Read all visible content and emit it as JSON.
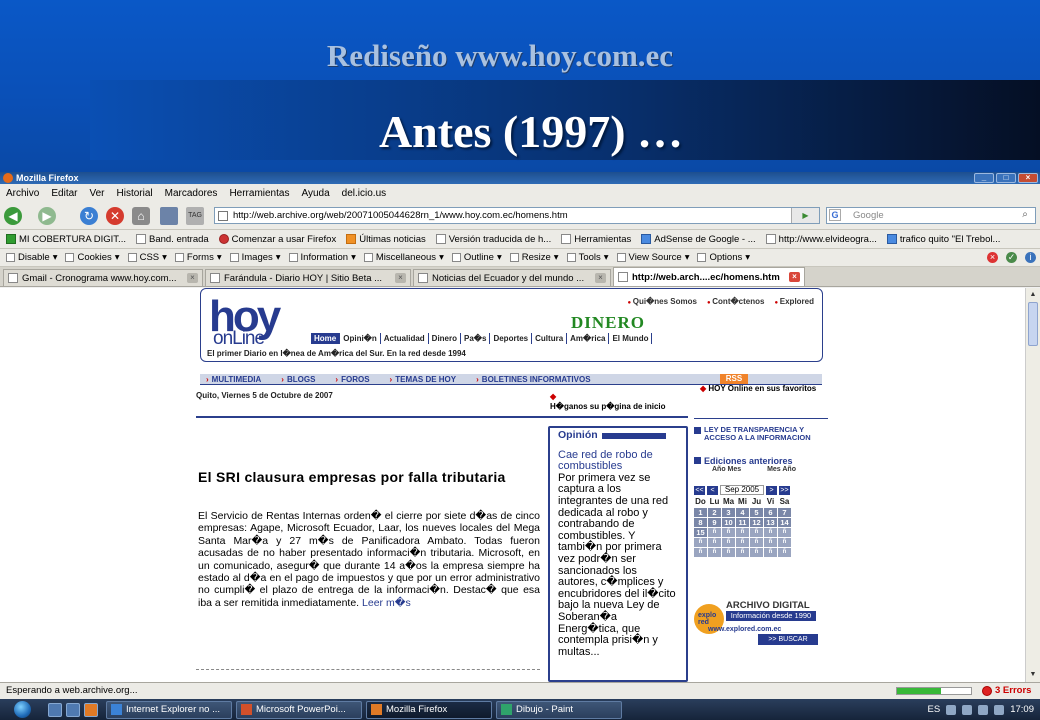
{
  "slide": {
    "subtitle": "Rediseño www.hoy.com.ec",
    "title": "Antes (1997) …"
  },
  "window": {
    "title": "Mozilla Firefox",
    "controls": [
      "_",
      "□",
      "×"
    ]
  },
  "menu": [
    "Archivo",
    "Editar",
    "Ver",
    "Historial",
    "Marcadores",
    "Herramientas",
    "Ayuda",
    "del.icio.us"
  ],
  "nav": {
    "back": "◀",
    "forward": "▶",
    "reload": "↻",
    "stop": "✕",
    "home": "⌂",
    "url": "http://web.archive.org/web/20071005044628rn_1/www.hoy.com.ec/homens.htm",
    "go": "▶",
    "search_placeholder": "Google",
    "search_engine": "G"
  },
  "bookmarks": [
    {
      "label": "MI COBERTURA DIGIT...",
      "icon": "green"
    },
    {
      "label": "Band. entrada",
      "icon": "plain"
    },
    {
      "label": "Comenzar a usar Firefox",
      "icon": "red"
    },
    {
      "label": "Últimas noticias",
      "icon": "orange"
    },
    {
      "label": "Versión traducida de h...",
      "icon": "plain"
    },
    {
      "label": "Herramientas",
      "icon": "plain"
    },
    {
      "label": "AdSense de Google - ...",
      "icon": "gd"
    },
    {
      "label": "http://www.elvideogra...",
      "icon": "plain"
    },
    {
      "label": "trafico quito \"El Trebol...",
      "icon": "gd"
    }
  ],
  "webdev": [
    "Disable",
    "Cookies",
    "CSS",
    "Forms",
    "Images",
    "Information",
    "Miscellaneous",
    "Outline",
    "Resize",
    "Tools",
    "View Source",
    "Options"
  ],
  "tabs": [
    {
      "label": "Gmail - Cronograma www.hoy.com...",
      "active": false
    },
    {
      "label": "Farándula - Diario HOY | Sitio Beta ...",
      "active": false
    },
    {
      "label": "Noticias del Ecuador y del mundo ...",
      "active": false
    },
    {
      "label": "http://web.arch....ec/homens.htm",
      "active": true
    }
  ],
  "site": {
    "logo_top": "hoy",
    "logo_bottom": "onLine",
    "top_links": [
      "Qui�nes Somos",
      "Cont�ctenos",
      "Explored"
    ],
    "dinero": "DINERO",
    "nav": [
      "Home",
      "Opini�n",
      "Actualidad",
      "Dinero",
      "Pa�s",
      "Deportes",
      "Cultura",
      "Am�rica",
      "El Mundo"
    ],
    "tagline": "El primer Diario en l�nea de Am�rica del Sur. En la red desde 1994",
    "sections": [
      "MULTIMEDIA",
      "BLOGS",
      "FOROS",
      "TEMAS DE HOY",
      "BOLETINES INFORMATIVOS"
    ],
    "rss": "RSS",
    "date": "Quito, Viernes 5 de Octubre de 2007",
    "hagan": "H�ganos su p�gina de inicio",
    "favoritos": "HOY Online en sus favoritos",
    "article": {
      "title": "El SRI clausura empresas por falla tributaria",
      "body": "El Servicio de Rentas Internas orden� el cierre por siete d�as de cinco empresas: Agape, Microsoft Ecuador, Laar, los nueves locales del Mega Santa Mar�a y 27 m�s de Panificadora Ambato. Todas fueron acusadas de no haber presentado informaci�n tributaria. Microsoft, en un comunicado, asegur� que durante 14 a�os la empresa siempre ha estado al d�a en el pago de impuestos y que por un error administrativo no cumpli� el plazo de entrega de la informaci�n. Destac� que esa iba a ser remitida inmediatamente.",
      "more": "Leer m�s"
    },
    "opinion": {
      "heading": "Opinión",
      "link": "Cae red de robo de combustibles",
      "text": "Por primera vez se captura a los integrantes de una red dedicada al robo y contrabando de combustibles. Y tambi�n por primera vez podr�n ser sancionados los autores, c�mplices y encubridores del il�cito bajo la nueva Ley de Soberan�a Energ�tica, que contempla prisi�n y multas..."
    },
    "ley": "LEY DE TRANSPARENCIA Y ACCESO A LA INFORMACION",
    "ediciones": {
      "title": "Ediciones anteriores",
      "year_label": "Año Mes",
      "month_label": "Mes Año"
    },
    "calendar": {
      "month": "Sep 2005",
      "prev": [
        "<<",
        "<"
      ],
      "next": [
        ">",
        ">>"
      ],
      "days": [
        "Do",
        "Lu",
        "Ma",
        "Mi",
        "Ju",
        "Vi",
        "Sa"
      ],
      "dates": [
        "1",
        "2",
        "3",
        "4",
        "5",
        "6",
        "7",
        "8",
        "9",
        "10",
        "11",
        "12",
        "13",
        "14",
        "15"
      ],
      "blank_label": "ñ"
    },
    "explored": {
      "logo": "explo red",
      "title": "ARCHIVO DIGITAL",
      "subtitle": "Información desde 1990",
      "url": "www.explored.com.ec",
      "button": ">> BUSCAR"
    }
  },
  "status": {
    "text": "Esperando a web.archive.org...",
    "errors": "3 Errors",
    "progress": 0.6
  },
  "taskbar": {
    "items": [
      {
        "label": "Internet Explorer no ...",
        "active": false,
        "color": "#3b82d6"
      },
      {
        "label": "Microsoft PowerPoi...",
        "active": false,
        "color": "#d2502a"
      },
      {
        "label": "Mozilla Firefox",
        "active": true,
        "color": "#e07a26"
      },
      {
        "label": "Dibujo - Paint",
        "active": false,
        "color": "#2fa36b"
      }
    ],
    "lang": "ES",
    "time": "17:09"
  }
}
